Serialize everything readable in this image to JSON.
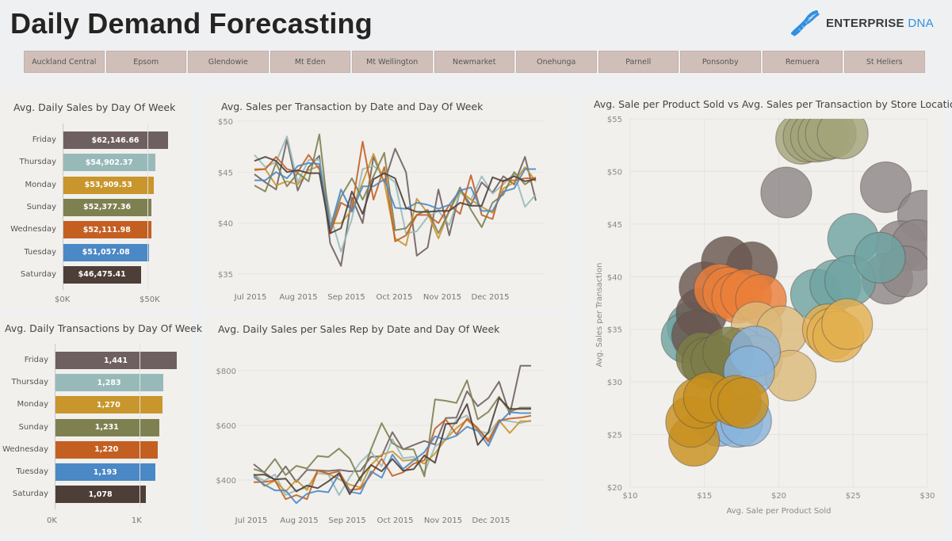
{
  "header": {
    "title": "Daily Demand Forecasting",
    "logo": {
      "icon": "dna-helix-icon",
      "text_main": "ENTERPRISE",
      "text_accent": "DNA",
      "accent_color": "#2f8fe0"
    }
  },
  "slicer": {
    "items": [
      "Auckland Central",
      "Epsom",
      "Glendowie",
      "Mt Eden",
      "Mt Wellington",
      "Newmarket",
      "Onehunga",
      "Parnell",
      "Ponsonby",
      "Remuera",
      "St Heliers"
    ]
  },
  "colors": {
    "Friday": "#6e6060",
    "Thursday": "#97bab9",
    "Monday": "#c8962c",
    "Sunday": "#7e8050",
    "Wednesday": "#c45f22",
    "Tuesday": "#4a88c6",
    "Saturday": "#4e3e38"
  },
  "chart_data": [
    {
      "id": "sales_by_dow",
      "type": "bar",
      "orientation": "horizontal",
      "title": "Avg. Daily Sales by Day Of Week",
      "categories": [
        "Friday",
        "Thursday",
        "Monday",
        "Sunday",
        "Wednesday",
        "Tuesday",
        "Saturday"
      ],
      "values": [
        62146.66,
        54902.37,
        53909.53,
        52377.36,
        52111.98,
        51057.08,
        46475.41
      ],
      "labels": [
        "$62,146.66",
        "$54,902.37",
        "$53,909.53",
        "$52,377.36",
        "$52,111.98",
        "$51,057.08",
        "$46,475.41"
      ],
      "xticks": [
        "$0K",
        "$50K"
      ],
      "xlim": [
        0,
        65000
      ]
    },
    {
      "id": "transactions_by_dow",
      "type": "bar",
      "orientation": "horizontal",
      "title": "Avg. Daily Transactions by Day Of Week",
      "categories": [
        "Friday",
        "Thursday",
        "Monday",
        "Sunday",
        "Wednesday",
        "Tuesday",
        "Saturday"
      ],
      "values": [
        1441,
        1283,
        1270,
        1231,
        1220,
        1193,
        1078
      ],
      "labels": [
        "1,441",
        "1,283",
        "1,270",
        "1,231",
        "1,220",
        "1,193",
        "1,078"
      ],
      "xticks": [
        "0K",
        "1K"
      ],
      "xlim": [
        0,
        1500
      ]
    },
    {
      "id": "sales_per_txn",
      "type": "line",
      "title": "Avg. Sales per Transaction by Date and Day Of Week",
      "xticks": [
        "Jul 2015",
        "Aug 2015",
        "Sep 2015",
        "Oct 2015",
        "Nov 2015",
        "Dec 2015"
      ],
      "yticks": [
        "$35",
        "$40",
        "$45",
        "$50"
      ],
      "ylim": [
        35,
        50
      ],
      "x_count": 27,
      "series": [
        {
          "name": "Friday",
          "values": [
            44.8,
            44.0,
            43.3,
            48.2,
            43.2,
            45.5,
            46.6,
            38.0,
            35.8,
            42.5,
            40.0,
            46.5,
            44.0,
            47.3,
            45.0,
            36.8,
            37.6,
            43.3,
            38.8,
            43.2,
            41.8,
            44.0,
            43.0,
            44.6,
            43.8,
            46.5,
            42.2
          ]
        },
        {
          "name": "Thursday",
          "values": [
            46.7,
            45.5,
            46.0,
            48.5,
            44.0,
            46.2,
            46.2,
            40.8,
            37.2,
            40.4,
            45.3,
            45.6,
            44.8,
            44.0,
            39.0,
            39.2,
            40.6,
            41.2,
            39.8,
            43.0,
            42.3,
            44.6,
            42.9,
            43.8,
            44.9,
            41.6,
            42.8
          ]
        },
        {
          "name": "Monday",
          "values": [
            45.3,
            45.3,
            43.7,
            44.1,
            43.8,
            45.2,
            45.6,
            40.0,
            40.0,
            41.3,
            44.0,
            46.8,
            44.0,
            38.5,
            37.8,
            42.4,
            41.0,
            38.5,
            41.2,
            43.2,
            42.3,
            41.6,
            41.0,
            43.4,
            44.0,
            45.5,
            44.1
          ]
        },
        {
          "name": "Sunday",
          "values": [
            43.7,
            43.1,
            45.9,
            43.6,
            44.9,
            44.1,
            48.7,
            39.3,
            42.6,
            44.4,
            42.3,
            44.6,
            46.9,
            39.3,
            39.5,
            40.8,
            41.3,
            39.0,
            41.2,
            43.5,
            41.3,
            39.6,
            42.0,
            42.8,
            45.0,
            43.8,
            44.5
          ]
        },
        {
          "name": "Wednesday",
          "values": [
            45.2,
            45.3,
            46.5,
            45.3,
            45.0,
            46.7,
            45.3,
            39.0,
            42.0,
            41.4,
            48.0,
            42.3,
            45.5,
            38.2,
            38.8,
            40.8,
            40.8,
            40.0,
            41.8,
            40.9,
            44.7,
            40.8,
            40.4,
            44.2,
            44.2,
            44.4,
            44.4
          ]
        },
        {
          "name": "Tuesday",
          "values": [
            44.2,
            44.2,
            45.0,
            44.4,
            45.6,
            45.9,
            45.8,
            39.5,
            43.3,
            41.1,
            43.6,
            43.6,
            44.3,
            41.5,
            41.4,
            42.0,
            41.8,
            41.4,
            41.8,
            43.2,
            43.5,
            41.2,
            41.2,
            43.1,
            43.4,
            45.3,
            45.3
          ]
        },
        {
          "name": "Saturday",
          "values": [
            46.1,
            46.5,
            46.1,
            45.0,
            45.2,
            44.9,
            44.9,
            39.0,
            39.5,
            43.1,
            40.9,
            44.3,
            44.9,
            44.4,
            41.5,
            41.1,
            41.1,
            41.2,
            41.2,
            42.0,
            41.7,
            41.7,
            44.5,
            44.1,
            44.6,
            44.1,
            44.3
          ]
        }
      ]
    },
    {
      "id": "sales_per_rep",
      "type": "line",
      "title": "Avg. Daily Sales per Sales Rep by Date and Day Of Week",
      "xticks": [
        "Jul 2015",
        "Aug 2015",
        "Sep 2015",
        "Oct 2015",
        "Nov 2015",
        "Dec 2015"
      ],
      "yticks": [
        "$400",
        "$600",
        "$800"
      ],
      "ylim": [
        310,
        880
      ],
      "x_count": 27,
      "series": [
        {
          "name": "Friday",
          "values": [
            458,
            427,
            400,
            450,
            393,
            437,
            435,
            433,
            437,
            432,
            433,
            485,
            487,
            575,
            512,
            528,
            543,
            530,
            627,
            628,
            725,
            670,
            700,
            760,
            640,
            818,
            818
          ]
        },
        {
          "name": "Thursday",
          "values": [
            418,
            397,
            420,
            345,
            363,
            372,
            425,
            420,
            345,
            410,
            465,
            503,
            450,
            550,
            480,
            485,
            426,
            523,
            548,
            620,
            636,
            580,
            570,
            620,
            615,
            608,
            618
          ]
        },
        {
          "name": "Monday",
          "values": [
            422,
            378,
            398,
            358,
            400,
            363,
            434,
            423,
            403,
            383,
            373,
            455,
            493,
            505,
            470,
            475,
            460,
            497,
            550,
            590,
            620,
            585,
            548,
            618,
            572,
            615,
            615
          ]
        },
        {
          "name": "Sunday",
          "values": [
            440,
            428,
            477,
            418,
            452,
            442,
            488,
            484,
            515,
            478,
            397,
            513,
            608,
            535,
            513,
            512,
            413,
            695,
            690,
            682,
            765,
            622,
            650,
            705,
            650,
            665,
            665
          ]
        },
        {
          "name": "Wednesday",
          "values": [
            392,
            393,
            398,
            330,
            345,
            330,
            436,
            423,
            432,
            363,
            368,
            420,
            478,
            415,
            428,
            460,
            472,
            588,
            622,
            567,
            625,
            590,
            540,
            617,
            625,
            628,
            635
          ]
        },
        {
          "name": "Tuesday",
          "values": [
            412,
            383,
            362,
            362,
            315,
            350,
            360,
            355,
            422,
            357,
            350,
            432,
            408,
            493,
            440,
            472,
            502,
            560,
            548,
            562,
            595,
            580,
            525,
            610,
            648,
            645,
            645
          ]
        },
        {
          "name": "Saturday",
          "values": [
            418,
            420,
            402,
            405,
            358,
            380,
            370,
            395,
            425,
            348,
            410,
            455,
            432,
            477,
            434,
            440,
            490,
            463,
            605,
            608,
            678,
            528,
            575,
            700,
            660,
            660,
            660
          ]
        }
      ]
    },
    {
      "id": "scatter_store",
      "type": "scatter",
      "title": "Avg. Sale per Product Sold vs Avg. Sales per Transaction by Store Location",
      "xlabel": "Avg. Sale per Product Sold",
      "ylabel": "Avg. Sales per Transaction",
      "xticks": [
        "$10",
        "$15",
        "$20",
        "$25",
        "$30"
      ],
      "yticks": [
        "$20",
        "$25",
        "$30",
        "$35",
        "$40",
        "$45",
        "$50",
        "$55"
      ],
      "xlim": [
        10,
        30
      ],
      "ylim": [
        20,
        55
      ],
      "groups": [
        {
          "color": "#a3a47a",
          "points": [
            [
              21.5,
              53.1
            ],
            [
              22.0,
              53.3
            ],
            [
              22.5,
              53.3
            ],
            [
              23.0,
              53.4
            ],
            [
              23.5,
              53.6
            ],
            [
              24.3,
              53.6
            ]
          ]
        },
        {
          "color": "#8f8688",
          "points": [
            [
              20.5,
              48.0
            ],
            [
              27.2,
              48.5
            ],
            [
              29.7,
              45.8
            ],
            [
              28.2,
              42.9
            ],
            [
              29.3,
              43.0
            ],
            [
              27.3,
              39.8
            ],
            [
              28.5,
              40.5
            ]
          ]
        },
        {
          "color": "#6fa3a2",
          "points": [
            [
              25.0,
              43.6
            ],
            [
              22.5,
              38.3
            ],
            [
              23.8,
              39.2
            ],
            [
              24.8,
              39.6
            ],
            [
              26.8,
              41.8
            ],
            [
              14.2,
              35.2
            ],
            [
              13.8,
              34.2
            ]
          ]
        },
        {
          "color": "#6a5751",
          "points": [
            [
              15.0,
              39.0
            ],
            [
              16.5,
              41.4
            ],
            [
              18.2,
              40.9
            ],
            [
              14.8,
              36.5
            ],
            [
              14.5,
              34.4
            ]
          ]
        },
        {
          "color": "#ea7f3a",
          "points": [
            [
              16.0,
              38.8
            ],
            [
              16.6,
              38.5
            ],
            [
              17.2,
              38.0
            ],
            [
              17.8,
              38.3
            ],
            [
              18.8,
              37.8
            ]
          ]
        },
        {
          "color": "#dcb97a",
          "points": [
            [
              18.5,
              35.2
            ],
            [
              20.2,
              34.8
            ],
            [
              17.5,
              32.7
            ],
            [
              18.5,
              32.0
            ],
            [
              20.8,
              30.6
            ]
          ]
        },
        {
          "color": "#7c7c48",
          "points": [
            [
              14.8,
              32.3
            ],
            [
              15.2,
              31.8
            ],
            [
              15.8,
              32.0
            ],
            [
              16.6,
              32.8
            ]
          ]
        },
        {
          "color": "#89b3dc",
          "points": [
            [
              18.4,
              32.9
            ],
            [
              18.0,
              31.0
            ],
            [
              16.0,
              26.3
            ],
            [
              17.2,
              26.2
            ],
            [
              17.8,
              26.3
            ]
          ]
        },
        {
          "color": "#e3b04f",
          "points": [
            [
              23.3,
              35.0
            ],
            [
              23.6,
              34.6
            ],
            [
              24.0,
              34.3
            ],
            [
              24.6,
              35.5
            ]
          ]
        },
        {
          "color": "#c8901f",
          "points": [
            [
              14.3,
              24.4
            ],
            [
              14.1,
              26.2
            ],
            [
              14.6,
              28.0
            ],
            [
              15.3,
              28.5
            ],
            [
              17.1,
              28.2
            ],
            [
              17.6,
              28.0
            ]
          ]
        }
      ]
    }
  ]
}
